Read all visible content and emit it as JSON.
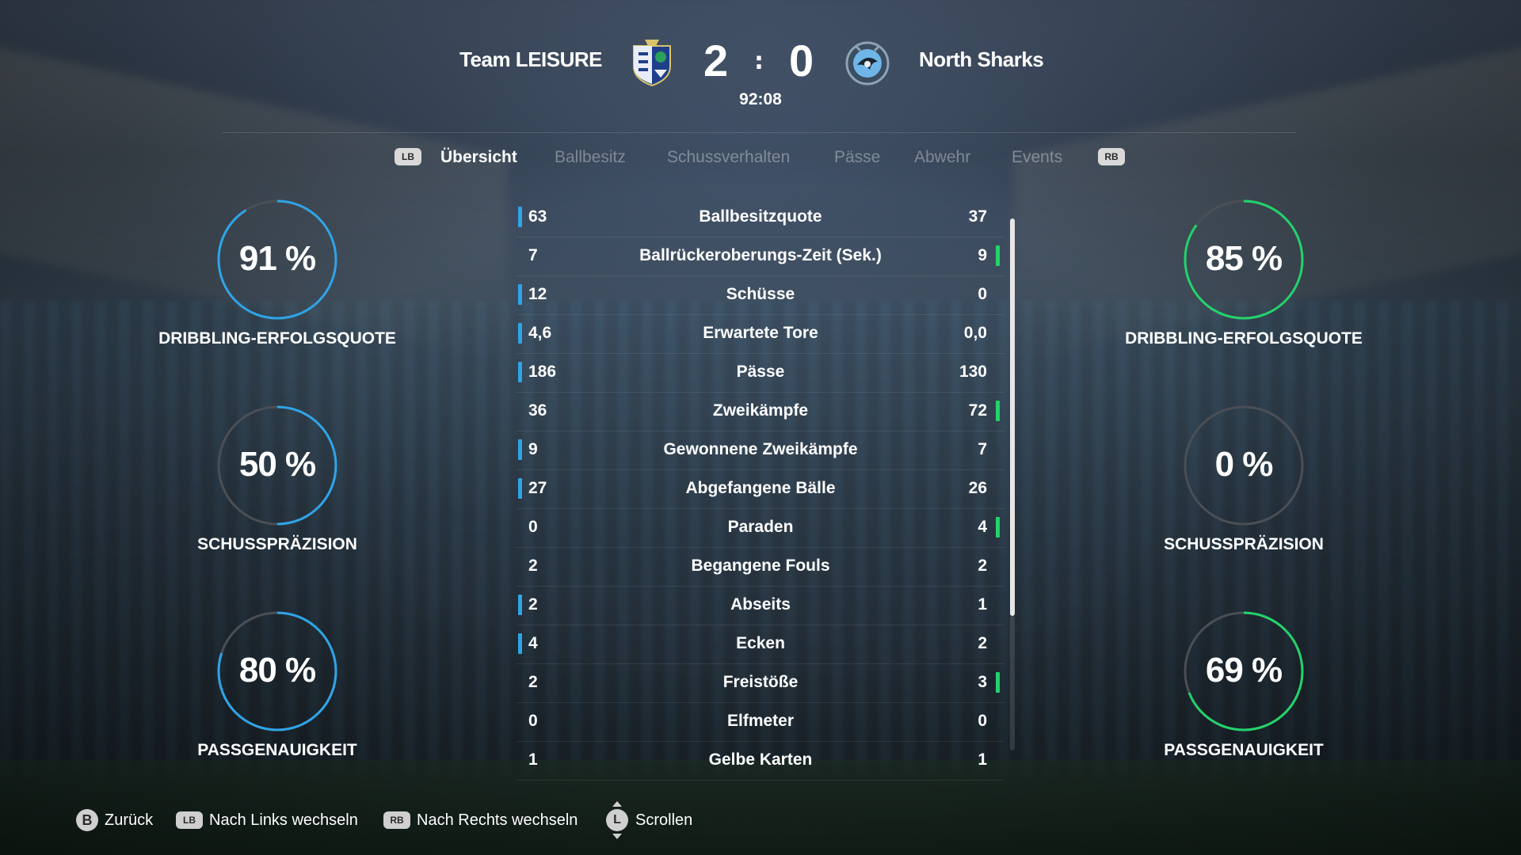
{
  "match": {
    "home_team": "Team LEISURE",
    "away_team": "North Sharks",
    "home_score": "2",
    "away_score": "0",
    "separator": ":",
    "clock": "92:08"
  },
  "tabs": {
    "lb": "LB",
    "rb": "RB",
    "items": [
      "Übersicht",
      "Ballbesitz",
      "Schussverhalten",
      "Pässe",
      "Abwehr",
      "Events"
    ],
    "active_index": 0
  },
  "stats": [
    {
      "label": "Ballbesitzquote",
      "home": "63",
      "away": "37",
      "lead": "home"
    },
    {
      "label": "Ballrückeroberungs-Zeit (Sek.)",
      "home": "7",
      "away": "9",
      "lead": "away"
    },
    {
      "label": "Schüsse",
      "home": "12",
      "away": "0",
      "lead": "home"
    },
    {
      "label": "Erwartete Tore",
      "home": "4,6",
      "away": "0,0",
      "lead": "home"
    },
    {
      "label": "Pässe",
      "home": "186",
      "away": "130",
      "lead": "home"
    },
    {
      "label": "Zweikämpfe",
      "home": "36",
      "away": "72",
      "lead": "away"
    },
    {
      "label": "Gewonnene Zweikämpfe",
      "home": "9",
      "away": "7",
      "lead": "home"
    },
    {
      "label": "Abgefangene Bälle",
      "home": "27",
      "away": "26",
      "lead": "home"
    },
    {
      "label": "Paraden",
      "home": "0",
      "away": "4",
      "lead": "away"
    },
    {
      "label": "Begangene Fouls",
      "home": "2",
      "away": "2",
      "lead": "none"
    },
    {
      "label": "Abseits",
      "home": "2",
      "away": "1",
      "lead": "home"
    },
    {
      "label": "Ecken",
      "home": "4",
      "away": "2",
      "lead": "home"
    },
    {
      "label": "Freistöße",
      "home": "2",
      "away": "3",
      "lead": "away"
    },
    {
      "label": "Elfmeter",
      "home": "0",
      "away": "0",
      "lead": "none"
    },
    {
      "label": "Gelbe Karten",
      "home": "1",
      "away": "1",
      "lead": "none"
    }
  ],
  "gauges": {
    "home": [
      {
        "value": "91 %",
        "fraction": 0.91,
        "label": "DRIBBLING-ERFOLGSQUOTE"
      },
      {
        "value": "50 %",
        "fraction": 0.5,
        "label": "SCHUSSPRÄZISION"
      },
      {
        "value": "80 %",
        "fraction": 0.8,
        "label": "PASSGENAUIGKEIT"
      }
    ],
    "away": [
      {
        "value": "85 %",
        "fraction": 0.85,
        "label": "DRIBBLING-ERFOLGSQUOTE"
      },
      {
        "value": "0 %",
        "fraction": 0.0,
        "label": "SCHUSSPRÄZISION"
      },
      {
        "value": "69 %",
        "fraction": 0.69,
        "label": "PASSGENAUIGKEIT"
      }
    ]
  },
  "colors": {
    "home_accent": "#2fa4e7",
    "away_accent": "#22d36b",
    "track": "#4a4f55"
  },
  "footer": {
    "back_key": "B",
    "back_label": "Zurück",
    "left_key": "LB",
    "left_label": "Nach Links wechseln",
    "right_key": "RB",
    "right_label": "Nach Rechts wechseln",
    "scroll_key": "L",
    "scroll_label": "Scrollen"
  }
}
